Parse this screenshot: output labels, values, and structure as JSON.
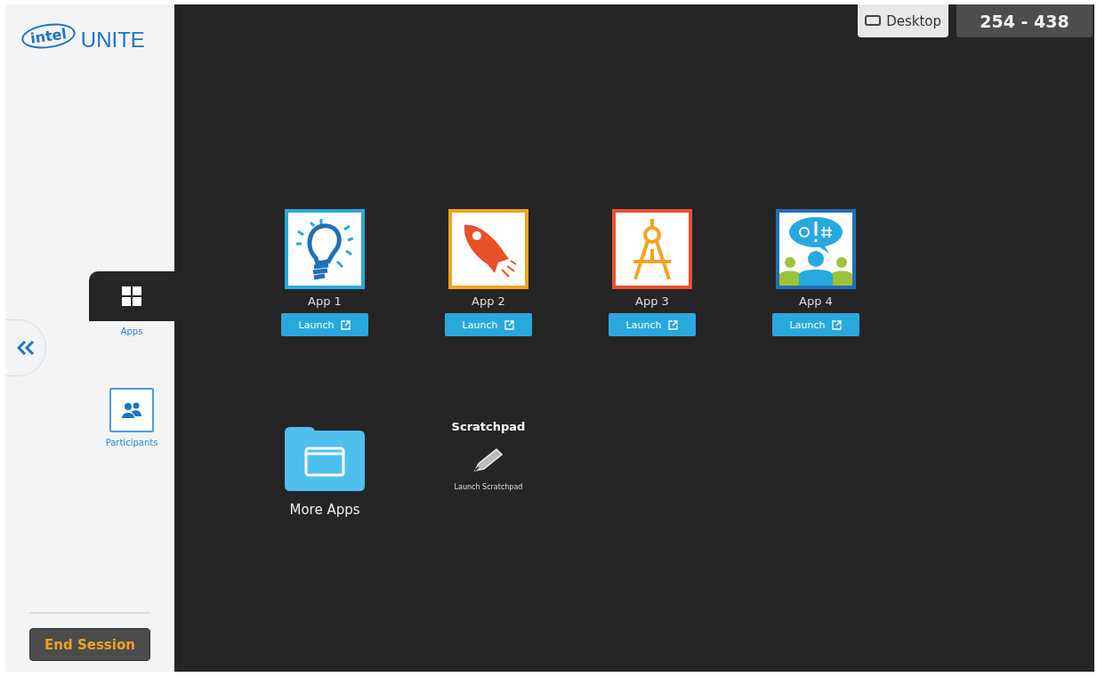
{
  "logo": {
    "brand": "intel",
    "product": "UNITE"
  },
  "nav": [
    {
      "label": "Apps",
      "kind": "apps",
      "selected": true
    },
    {
      "label": "Participants",
      "kind": "participants",
      "selected": false
    }
  ],
  "top_bar": {
    "desktop": "Desktop",
    "pin": "254 - 438"
  },
  "apps": [
    {
      "name": "App 1",
      "kind": "bulb",
      "color": "#29a8e0",
      "button": "Launch"
    },
    {
      "name": "App 2",
      "kind": "rocket",
      "color": "#f7a21b",
      "button": "Launch"
    },
    {
      "name": "App 3",
      "kind": "compass",
      "color": "#e8512a",
      "button": "Launch"
    },
    {
      "name": "App 4",
      "kind": "chat",
      "color": "#1f6fb8",
      "button": "Launch"
    }
  ],
  "more_apps": {
    "label": "More Apps"
  },
  "scratchpad": {
    "title": "Scratchpad",
    "link": "Launch Scratchpad"
  },
  "end_session": "End Session"
}
